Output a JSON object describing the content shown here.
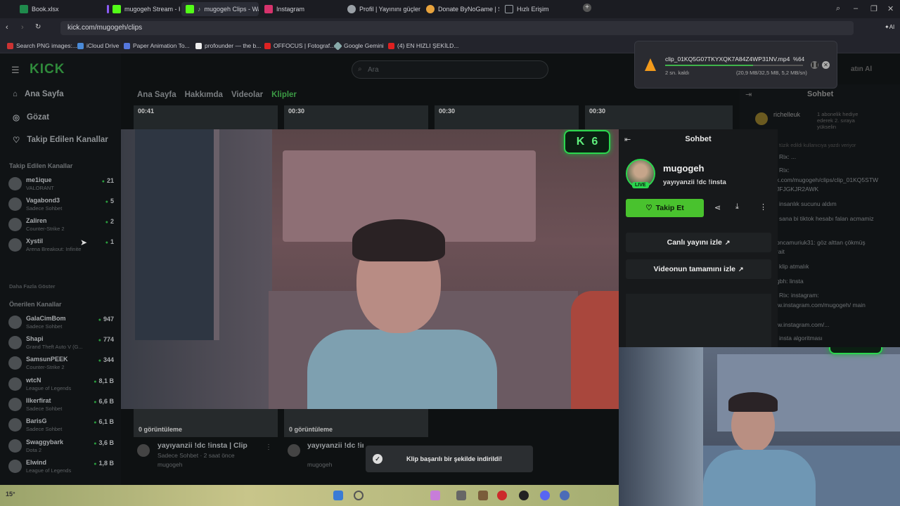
{
  "browser": {
    "tabs": [
      {
        "label": "Book.xlsx",
        "color": "#1f8a4c"
      },
      {
        "label": "mugogeh Stream - Kick D",
        "color": "#53fc18"
      },
      {
        "label": "mugogeh Clips - Wat",
        "color": "#53fc18",
        "active": true
      },
      {
        "label": "Instagram",
        "color": "#d6336c"
      },
      {
        "label": "Profil | Yayınını güçlendim",
        "color": "#9aa0a6"
      },
      {
        "label": "Donate ByNoGame | Strea",
        "color": "#e8a33d"
      },
      {
        "label": "Hızlı Erişim",
        "color": "#9aa0a6"
      }
    ],
    "url": "kick.com/mugogeh/clips",
    "bookmarks": [
      "Search PNG images:...",
      "iCloud Drive",
      "Paper Animation To...",
      "profounder — the b...",
      "OFFOCUS | Fotograf...",
      "Google Gemini",
      "(4) EN HIZLI ŞEKİLD..."
    ]
  },
  "download": {
    "filename": "clip_01KQ5G07TKYXQK7A84Z4WP31NV.mp4",
    "percent_label": "%64",
    "progress": 0.64,
    "remaining": "2 sn. kaldı",
    "size_speed": "(20,9 MB/32,5 MB, 5,2 MB/sn)"
  },
  "kick": {
    "search_placeholder": "Ara",
    "login_partial": "atın Al",
    "nav_main": [
      {
        "label": "Ana Sayfa",
        "icon": "home-icon"
      },
      {
        "label": "Gözat",
        "icon": "compass-icon"
      },
      {
        "label": "Takip Edilen Kanallar",
        "icon": "heart-icon"
      }
    ],
    "followed_title": "Takip Edilen Kanallar",
    "followed": [
      {
        "name": "me1ique",
        "game": "VALORANT",
        "count": "21"
      },
      {
        "name": "Vagabond3",
        "game": "Sadece Sohbet",
        "count": "5"
      },
      {
        "name": "Zaliren",
        "game": "Counter-Strike 2",
        "count": "2"
      },
      {
        "name": "Xystil",
        "game": "Arena Breakout: Infinite",
        "count": "1"
      }
    ],
    "show_more": "Daha Fazla Göster",
    "recommended_title": "Önerilen Kanallar",
    "recommended": [
      {
        "name": "GalaCimBom",
        "game": "Sadece Sohbet",
        "count": "947"
      },
      {
        "name": "Shapi",
        "game": "Grand Theft Auto V (G...",
        "count": "774"
      },
      {
        "name": "SamsunPEEK",
        "game": "Counter-Strike 2",
        "count": "344"
      },
      {
        "name": "wtcN",
        "game": "League of Legends",
        "count": "8,1 B"
      },
      {
        "name": "Ilkerfirat",
        "game": "Sadece Sohbet",
        "count": "6,6 B"
      },
      {
        "name": "BarisG",
        "game": "Sadece Sohbet",
        "count": "6,1 B"
      },
      {
        "name": "Swaggybark",
        "game": "Dota 2",
        "count": "3,6 B"
      },
      {
        "name": "Elwind",
        "game": "League of Legends",
        "count": "1,8 B"
      }
    ],
    "channel_tabs": [
      "Ana Sayfa",
      "Hakkımda",
      "Videolar",
      "Klipler"
    ],
    "thumb_durations": [
      "00:41",
      "00:30",
      "00:30",
      "00:30"
    ],
    "bottom_clips": [
      {
        "views": "0 görüntüleme",
        "title": "yayıyanzii !dc !insta | Clip",
        "meta": "Sadece Sohbet · 2 saat önce",
        "author": "mugogeh"
      },
      {
        "views": "0 görüntüleme",
        "title": "yayıyanzii !dc !insta | Clip",
        "meta": "",
        "author": "mugogeh"
      }
    ],
    "bg_chat_title": "Sohbet",
    "bg_chat_lines": [
      "richelleuk",
      "1 abonelik hediye",
      "ederek 2. sıraya",
      "yükselin",
      "tüzik edildi kullanıcıya yazdı veriyor",
      "Rix: ...",
      "Rix:",
      "k.com/mugogeh/clips/clip_01KQ5STW",
      "JFJGKJR2AWK",
      "insanlık sucunu aldım",
      "sana bi tiktok hesabı falan acmamiz",
      "oncamuriuk31: göz alttan çökmüş",
      "rait",
      "klip atmalık",
      "gbh: linsta",
      "Rix: instagram:",
      "ww.instagram.com/mugogeh/ main",
      "ww.instagram.com/...",
      "insta algoritması"
    ]
  },
  "clip_panel": {
    "title": "Sohbet",
    "streamer": "mugogeh",
    "live_label": "LIVE",
    "stream_title": "yayıyanzii !dc !insta",
    "follow_label": "Takip Et",
    "watch_live": "Canlı yayını izle",
    "watch_full": "Videonun tamamını izle"
  },
  "badge": {
    "number": "6"
  },
  "toast": {
    "message": "Klip başarılı bir şekilde indirildi!"
  },
  "colors": {
    "kick_green": "#53fc18",
    "follow_green": "#49c22e",
    "live_green": "#2bd64e"
  },
  "taskbar": {
    "weather": "15°"
  }
}
